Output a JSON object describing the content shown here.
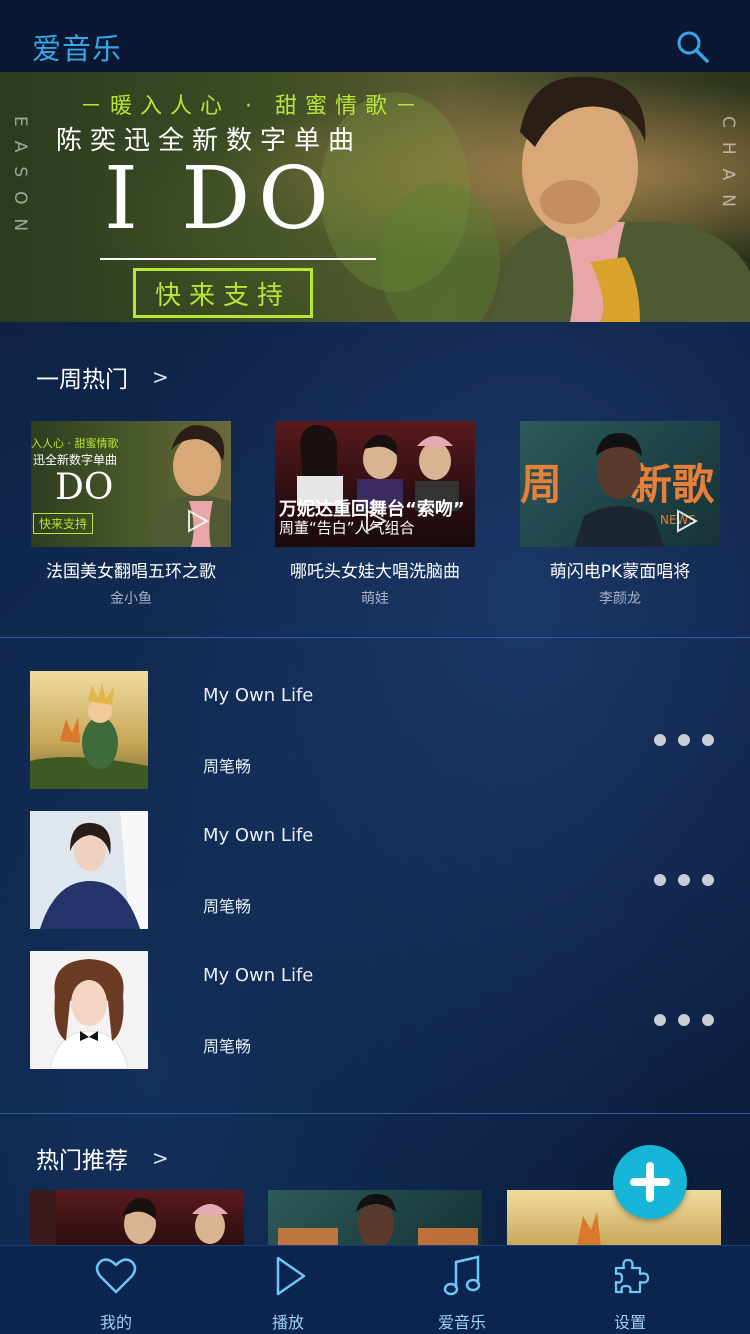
{
  "header": {
    "title": "爱音乐",
    "search_icon": "search-icon"
  },
  "banner": {
    "slogan": "－暖入人心 · 甜蜜情歌－",
    "subtitle": "陈奕迅全新数字单曲",
    "title": "I DO",
    "cta": "快来支持",
    "side_left": "EASON",
    "side_right": "CHAN",
    "accent": "#b8e637"
  },
  "weekly_hot": {
    "heading": "一周热门",
    "arrow": ">",
    "items": [
      {
        "name": "法国美女翻唱五环之歌",
        "artist": "金小鱼",
        "thumb_text_1": "入人心 · 甜蜜情歌",
        "thumb_text_2": "迅全新数字单曲",
        "thumb_text_3": "DO",
        "thumb_text_4": "快来支持"
      },
      {
        "name": "哪吒头女娃大唱洗脑曲",
        "artist": "萌娃",
        "thumb_text_1": "万妮达重回舞台“索吻”",
        "thumb_text_2": "周董“告白”人气组合"
      },
      {
        "name": "萌闪电PK蒙面唱将",
        "artist": "李颜龙",
        "thumb_text_1": "周",
        "thumb_text_2": "新歌",
        "thumb_text_3": "NEWS"
      }
    ]
  },
  "songs": [
    {
      "title": "My Own Life",
      "artist": "周笔畅"
    },
    {
      "title": "My Own Life",
      "artist": "周笔畅"
    },
    {
      "title": "My Own Life",
      "artist": "周笔畅"
    }
  ],
  "recommend": {
    "heading": "热门推荐",
    "arrow": ">"
  },
  "fab": {
    "icon": "plus-icon",
    "color": "#17b6d8"
  },
  "tabbar": {
    "items": [
      {
        "label": "我的",
        "icon": "heart-icon"
      },
      {
        "label": "播放",
        "icon": "play-icon"
      },
      {
        "label": "爱音乐",
        "icon": "music-note-icon"
      },
      {
        "label": "设置",
        "icon": "puzzle-icon"
      }
    ]
  },
  "colors": {
    "accent_blue": "#37a6e6",
    "tab_icon": "#6ec6f5",
    "background": "#0b1b38"
  }
}
